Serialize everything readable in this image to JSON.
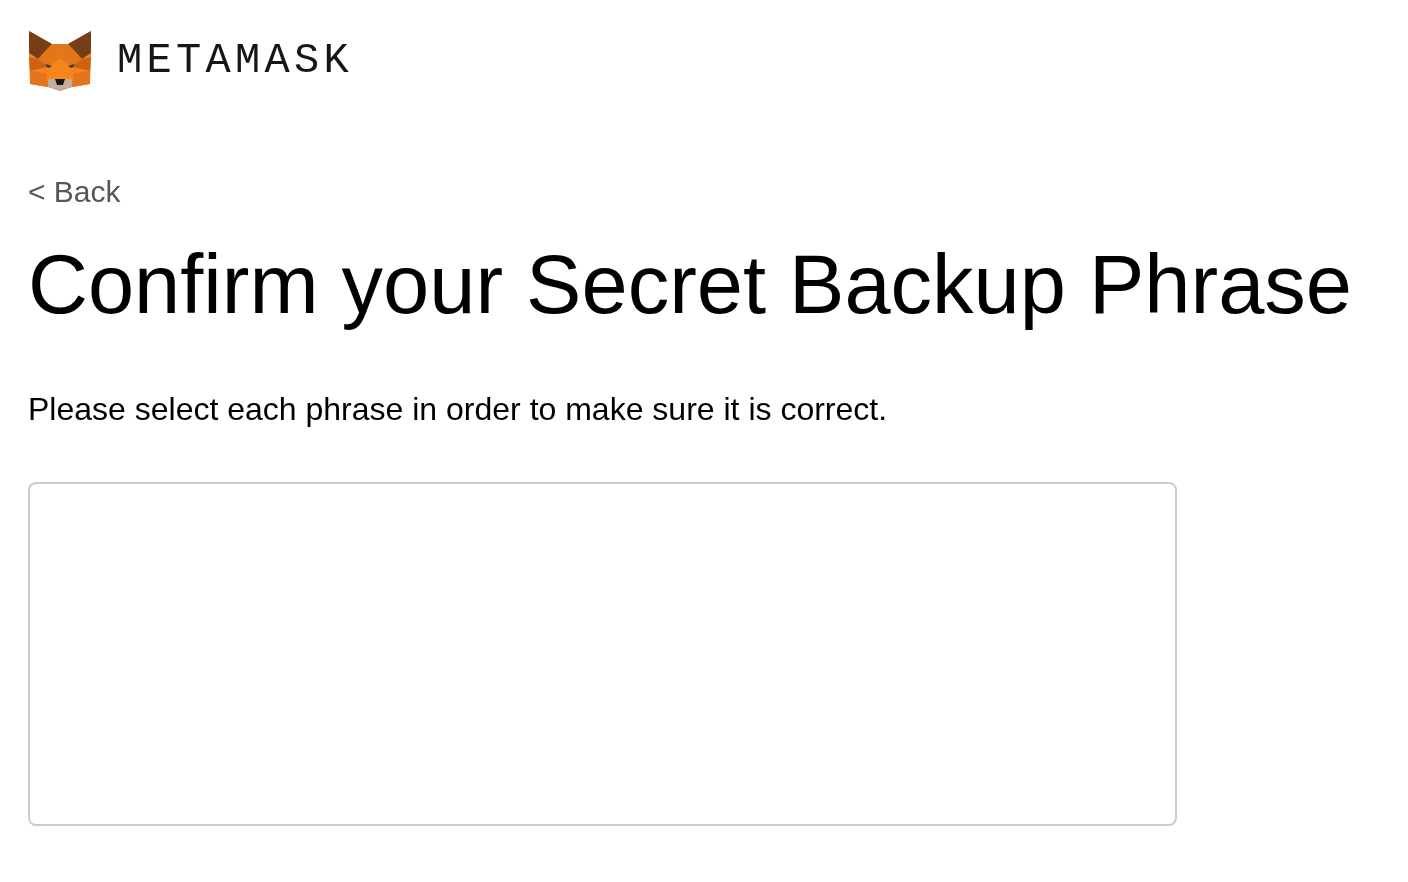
{
  "logo": {
    "wordmark": "METAMASK"
  },
  "back_link": {
    "label": "< Back"
  },
  "title": "Confirm your Secret Backup Phrase",
  "instructions": "Please select each phrase in order to make sure it is correct."
}
